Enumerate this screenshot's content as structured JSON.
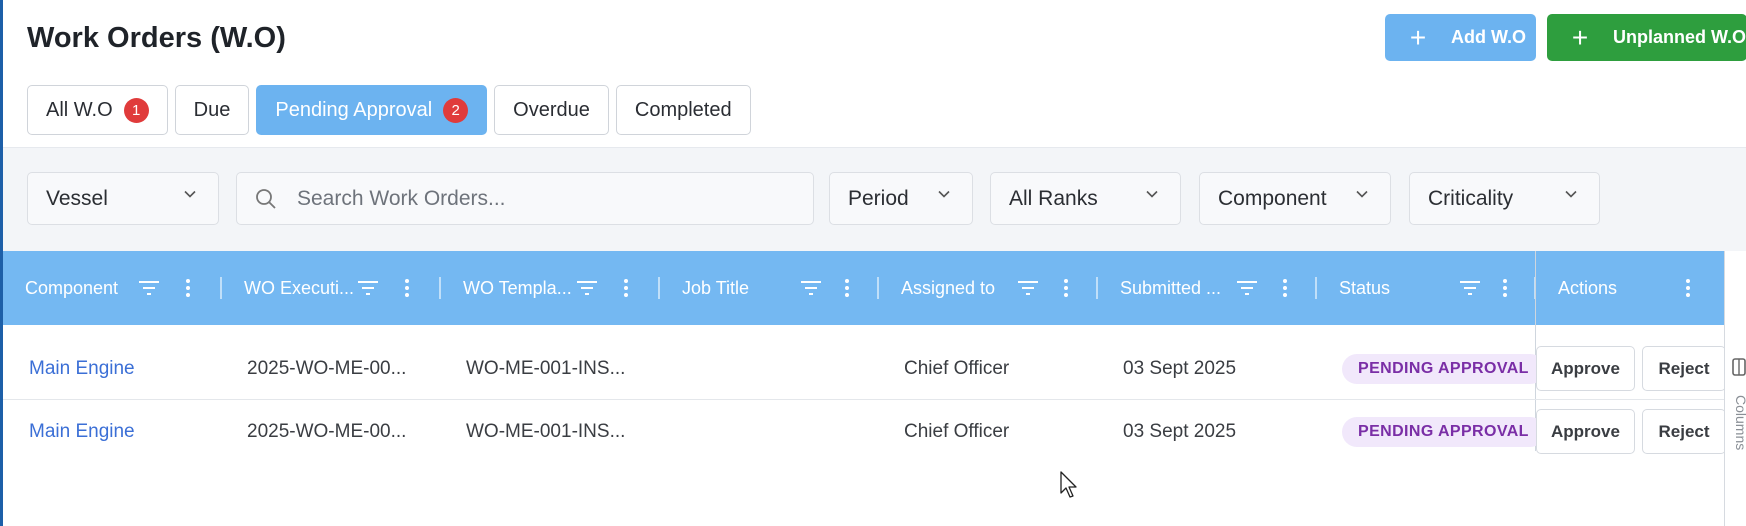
{
  "header": {
    "title": "Work Orders (W.O)",
    "add_button": "Add W.O",
    "unplanned_button": "Unplanned W.O",
    "colors": {
      "add": "#6cb3f0",
      "unplanned": "#2e9e3e"
    }
  },
  "tabs": [
    {
      "label": "All W.O",
      "badge": "1",
      "active": false
    },
    {
      "label": "Due",
      "badge": null,
      "active": false
    },
    {
      "label": "Pending Approval",
      "badge": "2",
      "active": true
    },
    {
      "label": "Overdue",
      "badge": null,
      "active": false
    },
    {
      "label": "Completed",
      "badge": null,
      "active": false
    }
  ],
  "filters": {
    "vessel": "Vessel",
    "search_placeholder": "Search Work Orders...",
    "period": "Period",
    "ranks": "All Ranks",
    "component": "Component",
    "criticality": "Criticality"
  },
  "table": {
    "columns": [
      "Component",
      "WO Executi...",
      "WO Templa...",
      "Job Title",
      "Assigned to",
      "Submitted ...",
      "Status",
      "Actions"
    ],
    "rows": [
      {
        "component": "Main Engine",
        "wo_execution": "2025-WO-ME-00...",
        "wo_template": "WO-ME-001-INS...",
        "job_title": "",
        "assigned_to": "Chief Officer",
        "submitted": "03 Sept 2025",
        "status": "PENDING APPROVAL"
      },
      {
        "component": "Main Engine",
        "wo_execution": "2025-WO-ME-00...",
        "wo_template": "WO-ME-001-INS...",
        "job_title": "",
        "assigned_to": "Chief Officer",
        "submitted": "03 Sept 2025",
        "status": "PENDING APPROVAL"
      }
    ],
    "approve_label": "Approve",
    "reject_label": "Reject",
    "header_color": "#74b8f2"
  },
  "side_panel": {
    "label": "Columns"
  }
}
